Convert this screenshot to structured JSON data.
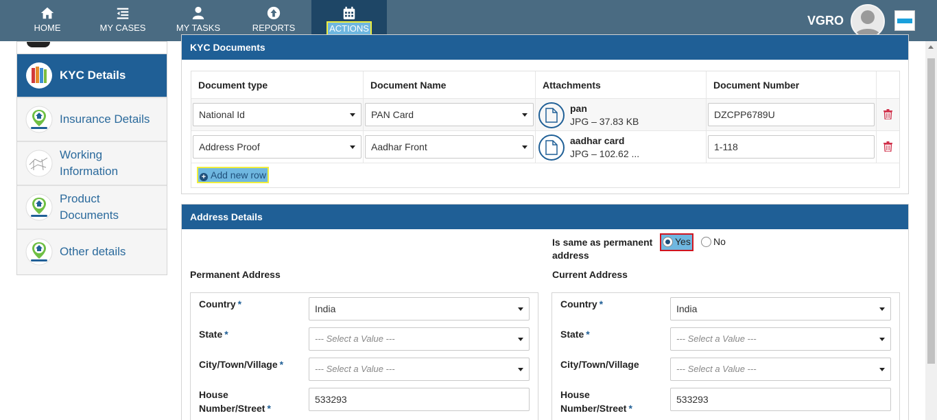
{
  "nav": {
    "items": [
      {
        "label": "HOME",
        "icon": "home-icon"
      },
      {
        "label": "MY CASES",
        "icon": "list-icon"
      },
      {
        "label": "MY TASKS",
        "icon": "user-icon"
      },
      {
        "label": "REPORTS",
        "icon": "upload-circle-icon"
      },
      {
        "label": "ACTIONS",
        "icon": "calendar-icon"
      }
    ],
    "brand": "VGRO"
  },
  "sidebar": {
    "items": [
      {
        "label": "KYC Details"
      },
      {
        "label": "Insurance Details"
      },
      {
        "label": "Working Information"
      },
      {
        "label": "Product Documents"
      },
      {
        "label": "Other details"
      }
    ]
  },
  "kyc": {
    "title": "KYC Documents",
    "headers": [
      "Document type",
      "Document Name",
      "Attachments",
      "Document Number"
    ],
    "rows": [
      {
        "type": "National Id",
        "name": "PAN Card",
        "file": "pan",
        "meta": "JPG – 37.83 KB",
        "number": "DZCPP6789U"
      },
      {
        "type": "Address Proof",
        "name": "Aadhar Front",
        "file": "aadhar card",
        "meta": "JPG – 102.62 ...",
        "number": "1-118"
      }
    ],
    "add_row": "Add new row"
  },
  "address": {
    "title": "Address Details",
    "same_label": "Is same as permanent address",
    "yes": "Yes",
    "no": "No",
    "permanent": {
      "title": "Permanent Address",
      "country_label": "Country",
      "country": "India",
      "state_label": "State",
      "state": "--- Select a Value ---",
      "city_label": "City/Town/Village",
      "city": "--- Select a Value ---",
      "house_label": "House Number/Street",
      "house": "533293"
    },
    "current": {
      "title": "Current Address",
      "country_label": "Country",
      "country": "India",
      "state_label": "State",
      "state": "--- Select a Value ---",
      "city_label": "City/Town/Village",
      "city": "--- Select a Value ---",
      "house_label": "House Number/Street",
      "house": "533293"
    },
    "required_mark": "*"
  }
}
